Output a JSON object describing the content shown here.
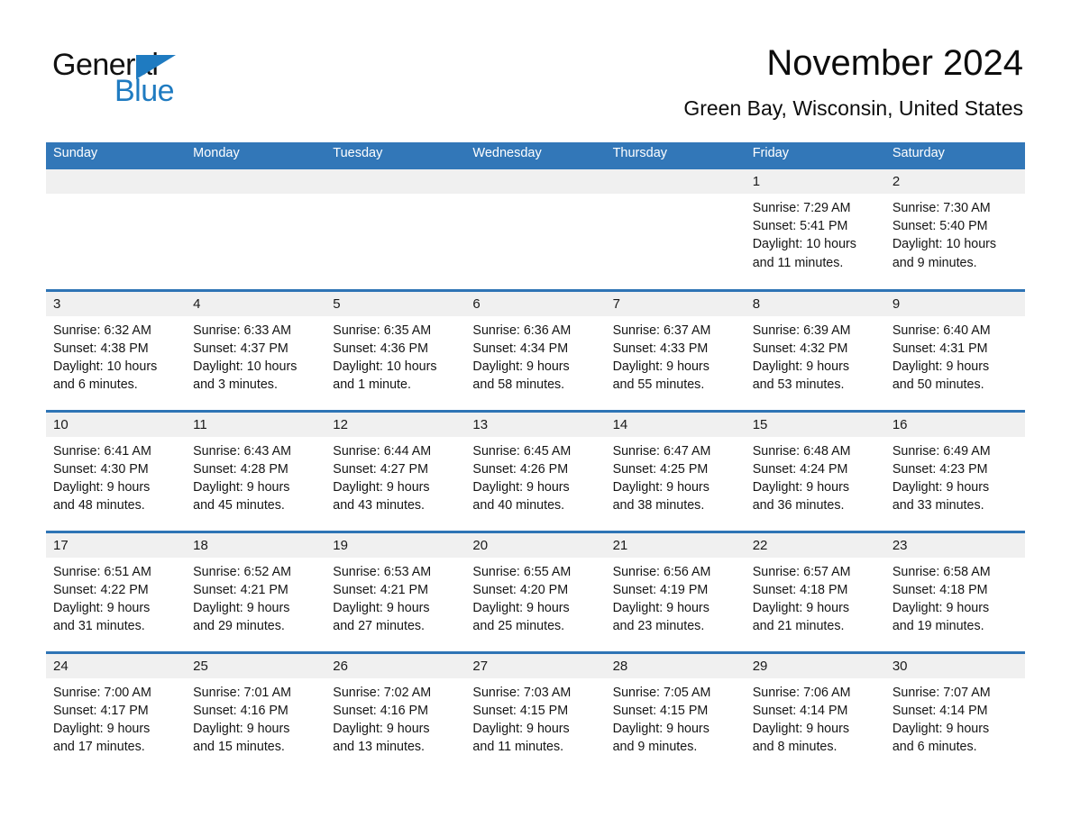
{
  "brand": {
    "logo_text_top": "General",
    "logo_text_bottom": "Blue",
    "accent_color": "#1F7BC1"
  },
  "header": {
    "month_title": "November 2024",
    "location": "Green Bay, Wisconsin, United States"
  },
  "calendar": {
    "header_bg": "#3277B8",
    "row_divider_color": "#2E74B5",
    "daynum_band_bg": "#F0F0F0",
    "day_names": [
      "Sunday",
      "Monday",
      "Tuesday",
      "Wednesday",
      "Thursday",
      "Friday",
      "Saturday"
    ],
    "weeks": [
      [
        {
          "empty": true
        },
        {
          "empty": true
        },
        {
          "empty": true
        },
        {
          "empty": true
        },
        {
          "empty": true
        },
        {
          "day": "1",
          "sunrise": "Sunrise: 7:29 AM",
          "sunset": "Sunset: 5:41 PM",
          "daylight_line1": "Daylight: 10 hours",
          "daylight_line2": "and 11 minutes."
        },
        {
          "day": "2",
          "sunrise": "Sunrise: 7:30 AM",
          "sunset": "Sunset: 5:40 PM",
          "daylight_line1": "Daylight: 10 hours",
          "daylight_line2": "and 9 minutes."
        }
      ],
      [
        {
          "day": "3",
          "sunrise": "Sunrise: 6:32 AM",
          "sunset": "Sunset: 4:38 PM",
          "daylight_line1": "Daylight: 10 hours",
          "daylight_line2": "and 6 minutes."
        },
        {
          "day": "4",
          "sunrise": "Sunrise: 6:33 AM",
          "sunset": "Sunset: 4:37 PM",
          "daylight_line1": "Daylight: 10 hours",
          "daylight_line2": "and 3 minutes."
        },
        {
          "day": "5",
          "sunrise": "Sunrise: 6:35 AM",
          "sunset": "Sunset: 4:36 PM",
          "daylight_line1": "Daylight: 10 hours",
          "daylight_line2": "and 1 minute."
        },
        {
          "day": "6",
          "sunrise": "Sunrise: 6:36 AM",
          "sunset": "Sunset: 4:34 PM",
          "daylight_line1": "Daylight: 9 hours",
          "daylight_line2": "and 58 minutes."
        },
        {
          "day": "7",
          "sunrise": "Sunrise: 6:37 AM",
          "sunset": "Sunset: 4:33 PM",
          "daylight_line1": "Daylight: 9 hours",
          "daylight_line2": "and 55 minutes."
        },
        {
          "day": "8",
          "sunrise": "Sunrise: 6:39 AM",
          "sunset": "Sunset: 4:32 PM",
          "daylight_line1": "Daylight: 9 hours",
          "daylight_line2": "and 53 minutes."
        },
        {
          "day": "9",
          "sunrise": "Sunrise: 6:40 AM",
          "sunset": "Sunset: 4:31 PM",
          "daylight_line1": "Daylight: 9 hours",
          "daylight_line2": "and 50 minutes."
        }
      ],
      [
        {
          "day": "10",
          "sunrise": "Sunrise: 6:41 AM",
          "sunset": "Sunset: 4:30 PM",
          "daylight_line1": "Daylight: 9 hours",
          "daylight_line2": "and 48 minutes."
        },
        {
          "day": "11",
          "sunrise": "Sunrise: 6:43 AM",
          "sunset": "Sunset: 4:28 PM",
          "daylight_line1": "Daylight: 9 hours",
          "daylight_line2": "and 45 minutes."
        },
        {
          "day": "12",
          "sunrise": "Sunrise: 6:44 AM",
          "sunset": "Sunset: 4:27 PM",
          "daylight_line1": "Daylight: 9 hours",
          "daylight_line2": "and 43 minutes."
        },
        {
          "day": "13",
          "sunrise": "Sunrise: 6:45 AM",
          "sunset": "Sunset: 4:26 PM",
          "daylight_line1": "Daylight: 9 hours",
          "daylight_line2": "and 40 minutes."
        },
        {
          "day": "14",
          "sunrise": "Sunrise: 6:47 AM",
          "sunset": "Sunset: 4:25 PM",
          "daylight_line1": "Daylight: 9 hours",
          "daylight_line2": "and 38 minutes."
        },
        {
          "day": "15",
          "sunrise": "Sunrise: 6:48 AM",
          "sunset": "Sunset: 4:24 PM",
          "daylight_line1": "Daylight: 9 hours",
          "daylight_line2": "and 36 minutes."
        },
        {
          "day": "16",
          "sunrise": "Sunrise: 6:49 AM",
          "sunset": "Sunset: 4:23 PM",
          "daylight_line1": "Daylight: 9 hours",
          "daylight_line2": "and 33 minutes."
        }
      ],
      [
        {
          "day": "17",
          "sunrise": "Sunrise: 6:51 AM",
          "sunset": "Sunset: 4:22 PM",
          "daylight_line1": "Daylight: 9 hours",
          "daylight_line2": "and 31 minutes."
        },
        {
          "day": "18",
          "sunrise": "Sunrise: 6:52 AM",
          "sunset": "Sunset: 4:21 PM",
          "daylight_line1": "Daylight: 9 hours",
          "daylight_line2": "and 29 minutes."
        },
        {
          "day": "19",
          "sunrise": "Sunrise: 6:53 AM",
          "sunset": "Sunset: 4:21 PM",
          "daylight_line1": "Daylight: 9 hours",
          "daylight_line2": "and 27 minutes."
        },
        {
          "day": "20",
          "sunrise": "Sunrise: 6:55 AM",
          "sunset": "Sunset: 4:20 PM",
          "daylight_line1": "Daylight: 9 hours",
          "daylight_line2": "and 25 minutes."
        },
        {
          "day": "21",
          "sunrise": "Sunrise: 6:56 AM",
          "sunset": "Sunset: 4:19 PM",
          "daylight_line1": "Daylight: 9 hours",
          "daylight_line2": "and 23 minutes."
        },
        {
          "day": "22",
          "sunrise": "Sunrise: 6:57 AM",
          "sunset": "Sunset: 4:18 PM",
          "daylight_line1": "Daylight: 9 hours",
          "daylight_line2": "and 21 minutes."
        },
        {
          "day": "23",
          "sunrise": "Sunrise: 6:58 AM",
          "sunset": "Sunset: 4:18 PM",
          "daylight_line1": "Daylight: 9 hours",
          "daylight_line2": "and 19 minutes."
        }
      ],
      [
        {
          "day": "24",
          "sunrise": "Sunrise: 7:00 AM",
          "sunset": "Sunset: 4:17 PM",
          "daylight_line1": "Daylight: 9 hours",
          "daylight_line2": "and 17 minutes."
        },
        {
          "day": "25",
          "sunrise": "Sunrise: 7:01 AM",
          "sunset": "Sunset: 4:16 PM",
          "daylight_line1": "Daylight: 9 hours",
          "daylight_line2": "and 15 minutes."
        },
        {
          "day": "26",
          "sunrise": "Sunrise: 7:02 AM",
          "sunset": "Sunset: 4:16 PM",
          "daylight_line1": "Daylight: 9 hours",
          "daylight_line2": "and 13 minutes."
        },
        {
          "day": "27",
          "sunrise": "Sunrise: 7:03 AM",
          "sunset": "Sunset: 4:15 PM",
          "daylight_line1": "Daylight: 9 hours",
          "daylight_line2": "and 11 minutes."
        },
        {
          "day": "28",
          "sunrise": "Sunrise: 7:05 AM",
          "sunset": "Sunset: 4:15 PM",
          "daylight_line1": "Daylight: 9 hours",
          "daylight_line2": "and 9 minutes."
        },
        {
          "day": "29",
          "sunrise": "Sunrise: 7:06 AM",
          "sunset": "Sunset: 4:14 PM",
          "daylight_line1": "Daylight: 9 hours",
          "daylight_line2": "and 8 minutes."
        },
        {
          "day": "30",
          "sunrise": "Sunrise: 7:07 AM",
          "sunset": "Sunset: 4:14 PM",
          "daylight_line1": "Daylight: 9 hours",
          "daylight_line2": "and 6 minutes."
        }
      ]
    ]
  }
}
